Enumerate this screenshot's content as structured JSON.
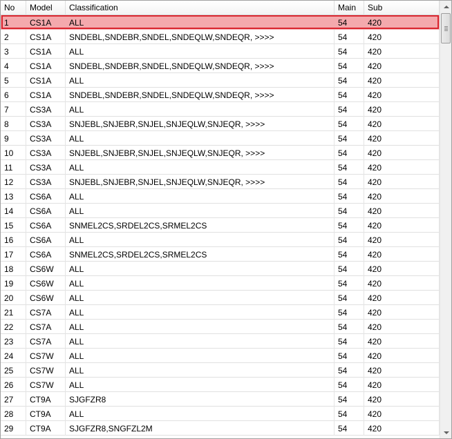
{
  "columns": [
    "No",
    "Model",
    "Classification",
    "Main",
    "Sub"
  ],
  "selected_index": 0,
  "rows": [
    {
      "no": "1",
      "model": "CS1A",
      "classification": "ALL",
      "main": "54",
      "sub": "420"
    },
    {
      "no": "2",
      "model": "CS1A",
      "classification": "SNDEBL,SNDEBR,SNDEL,SNDEQLW,SNDEQR,  >>>>",
      "main": "54",
      "sub": "420"
    },
    {
      "no": "3",
      "model": "CS1A",
      "classification": "ALL",
      "main": "54",
      "sub": "420"
    },
    {
      "no": "4",
      "model": "CS1A",
      "classification": "SNDEBL,SNDEBR,SNDEL,SNDEQLW,SNDEQR,  >>>>",
      "main": "54",
      "sub": "420"
    },
    {
      "no": "5",
      "model": "CS1A",
      "classification": "ALL",
      "main": "54",
      "sub": "420"
    },
    {
      "no": "6",
      "model": "CS1A",
      "classification": "SNDEBL,SNDEBR,SNDEL,SNDEQLW,SNDEQR,  >>>>",
      "main": "54",
      "sub": "420"
    },
    {
      "no": "7",
      "model": "CS3A",
      "classification": "ALL",
      "main": "54",
      "sub": "420"
    },
    {
      "no": "8",
      "model": "CS3A",
      "classification": "SNJEBL,SNJEBR,SNJEL,SNJEQLW,SNJEQR,  >>>>",
      "main": "54",
      "sub": "420"
    },
    {
      "no": "9",
      "model": "CS3A",
      "classification": "ALL",
      "main": "54",
      "sub": "420"
    },
    {
      "no": "10",
      "model": "CS3A",
      "classification": "SNJEBL,SNJEBR,SNJEL,SNJEQLW,SNJEQR,  >>>>",
      "main": "54",
      "sub": "420"
    },
    {
      "no": "11",
      "model": "CS3A",
      "classification": "ALL",
      "main": "54",
      "sub": "420"
    },
    {
      "no": "12",
      "model": "CS3A",
      "classification": "SNJEBL,SNJEBR,SNJEL,SNJEQLW,SNJEQR,  >>>>",
      "main": "54",
      "sub": "420"
    },
    {
      "no": "13",
      "model": "CS6A",
      "classification": "ALL",
      "main": "54",
      "sub": "420"
    },
    {
      "no": "14",
      "model": "CS6A",
      "classification": "ALL",
      "main": "54",
      "sub": "420"
    },
    {
      "no": "15",
      "model": "CS6A",
      "classification": "SNMEL2CS,SRDEL2CS,SRMEL2CS",
      "main": "54",
      "sub": "420"
    },
    {
      "no": "16",
      "model": "CS6A",
      "classification": "ALL",
      "main": "54",
      "sub": "420"
    },
    {
      "no": "17",
      "model": "CS6A",
      "classification": "SNMEL2CS,SRDEL2CS,SRMEL2CS",
      "main": "54",
      "sub": "420"
    },
    {
      "no": "18",
      "model": "CS6W",
      "classification": "ALL",
      "main": "54",
      "sub": "420"
    },
    {
      "no": "19",
      "model": "CS6W",
      "classification": "ALL",
      "main": "54",
      "sub": "420"
    },
    {
      "no": "20",
      "model": "CS6W",
      "classification": "ALL",
      "main": "54",
      "sub": "420"
    },
    {
      "no": "21",
      "model": "CS7A",
      "classification": "ALL",
      "main": "54",
      "sub": "420"
    },
    {
      "no": "22",
      "model": "CS7A",
      "classification": "ALL",
      "main": "54",
      "sub": "420"
    },
    {
      "no": "23",
      "model": "CS7A",
      "classification": "ALL",
      "main": "54",
      "sub": "420"
    },
    {
      "no": "24",
      "model": "CS7W",
      "classification": "ALL",
      "main": "54",
      "sub": "420"
    },
    {
      "no": "25",
      "model": "CS7W",
      "classification": "ALL",
      "main": "54",
      "sub": "420"
    },
    {
      "no": "26",
      "model": "CS7W",
      "classification": "ALL",
      "main": "54",
      "sub": "420"
    },
    {
      "no": "27",
      "model": "CT9A",
      "classification": "SJGFZR8",
      "main": "54",
      "sub": "420"
    },
    {
      "no": "28",
      "model": "CT9A",
      "classification": "ALL",
      "main": "54",
      "sub": "420"
    },
    {
      "no": "29",
      "model": "CT9A",
      "classification": "SJGFZR8,SNGFZL2M",
      "main": "54",
      "sub": "420"
    }
  ],
  "scrollbar": {
    "up_icon": "arrow-up-icon",
    "down_icon": "arrow-down-icon"
  }
}
